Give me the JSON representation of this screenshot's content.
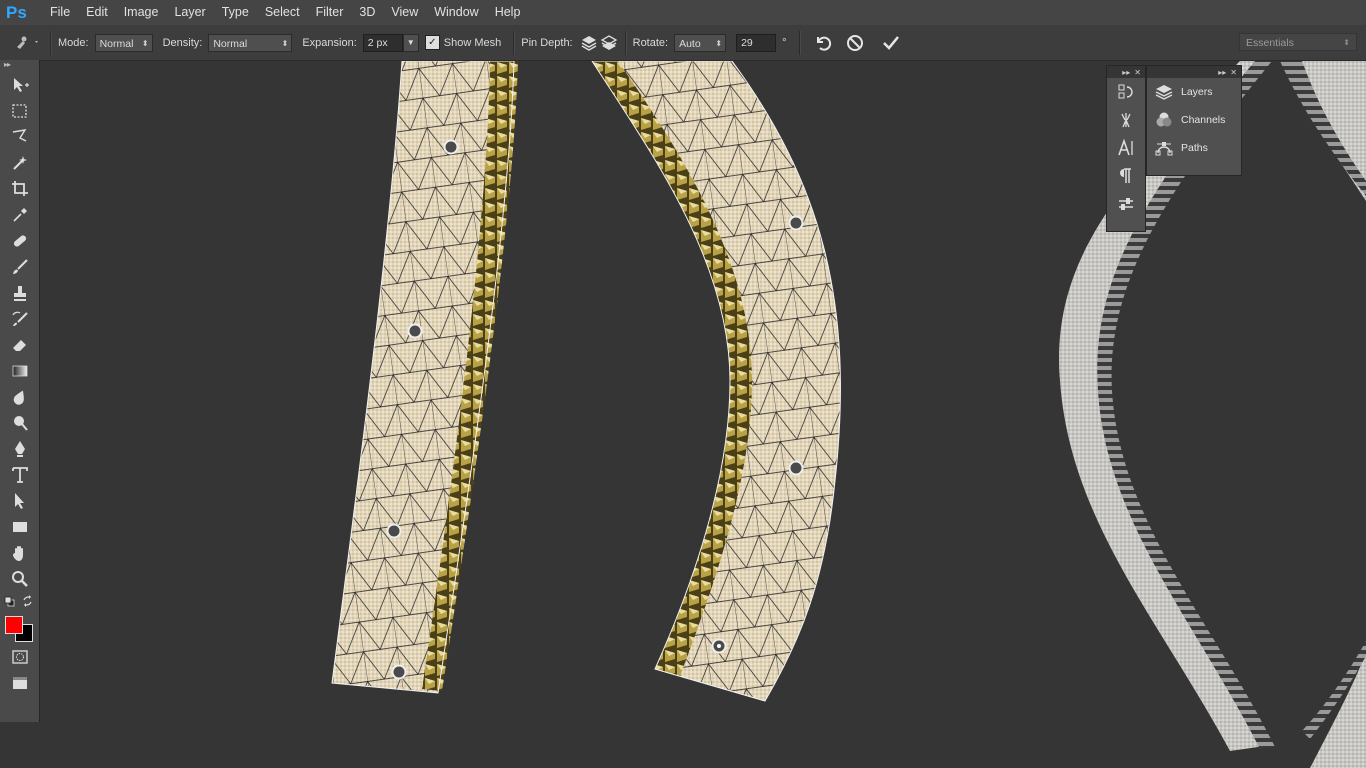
{
  "app": {
    "logo": "Ps"
  },
  "menu": [
    "File",
    "Edit",
    "Image",
    "Layer",
    "Type",
    "Select",
    "Filter",
    "3D",
    "View",
    "Window",
    "Help"
  ],
  "options": {
    "mode_label": "Mode:",
    "mode_value": "Normal",
    "density_label": "Density:",
    "density_value": "Normal",
    "expansion_label": "Expansion:",
    "expansion_value": "2 px",
    "show_mesh_label": "Show Mesh",
    "show_mesh_checked": true,
    "pin_depth_label": "Pin Depth:",
    "rotate_label": "Rotate:",
    "rotate_value": "Auto",
    "rotate_degrees": "29",
    "degree_symbol": "°",
    "workspace": "Essentials"
  },
  "tools": [
    "move-icon",
    "marquee-icon",
    "lasso-icon",
    "magic-wand-icon",
    "crop-icon",
    "eyedropper-icon",
    "healing-brush-icon",
    "brush-icon",
    "clone-stamp-icon",
    "history-brush-icon",
    "eraser-icon",
    "gradient-icon",
    "blur-icon",
    "dodge-icon",
    "pen-icon",
    "type-icon",
    "path-selection-icon",
    "rectangle-icon",
    "hand-icon",
    "zoom-icon"
  ],
  "colors": {
    "foreground": "#ff0000",
    "background": "#000000",
    "accent": "#31a8ff"
  },
  "panels": {
    "items": [
      {
        "label": "Layers",
        "icon": "layers-icon"
      },
      {
        "label": "Channels",
        "icon": "channels-icon"
      },
      {
        "label": "Paths",
        "icon": "paths-icon"
      }
    ]
  }
}
